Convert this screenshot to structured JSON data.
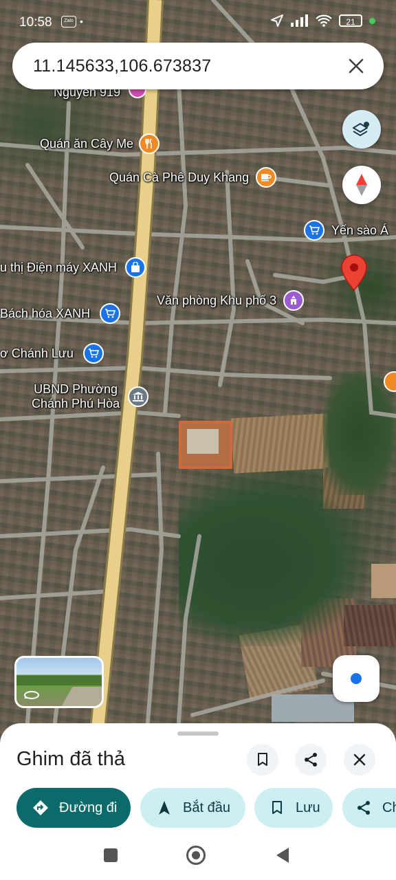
{
  "status_bar": {
    "time": "10:58",
    "app_badge": "Zalo",
    "dot": "•",
    "battery": "21"
  },
  "search": {
    "query": "11.145633,106.673837"
  },
  "map": {
    "pois": [
      {
        "label": "Nguyễn 919",
        "icon": "store-icon",
        "color": "#d04db0"
      },
      {
        "label": "Quán ăn Cây Me",
        "icon": "restaurant-icon",
        "color": "#f08a24"
      },
      {
        "label": "Quán Cà Phê Duy Khang",
        "icon": "cafe-icon",
        "color": "#f08a24"
      },
      {
        "label": "Yến sào Á",
        "icon": "shopping-cart-icon",
        "color": "#1a73e8"
      },
      {
        "label": "u thị Điện máy XANH",
        "icon": "shopping-bag-icon",
        "color": "#1a73e8"
      },
      {
        "label": "Văn phòng Khu phố 3",
        "icon": "government-icon",
        "color": "#9c5bd0"
      },
      {
        "label": "Bách hóa XANH",
        "icon": "shopping-cart-icon",
        "color": "#1a73e8"
      },
      {
        "label": "ơ Chánh Lưu",
        "icon": "shopping-cart-icon",
        "color": "#1a73e8"
      },
      {
        "label": "UBND Phường",
        "icon": "civic-building-icon",
        "color": "#6b7b86"
      },
      {
        "label": "Chánh Phú Hòa",
        "icon": "",
        "color": ""
      }
    ],
    "pin_color": "#ea4335"
  },
  "sheet": {
    "title": "Ghim đã thả",
    "actions": {
      "directions": "Đường đi",
      "start": "Bắt đầu",
      "save": "Lưu",
      "share": "Ch"
    }
  },
  "colors": {
    "primary": "#0b6b6b",
    "tonal": "#cdeef3",
    "road_main": "#e8d08a"
  }
}
